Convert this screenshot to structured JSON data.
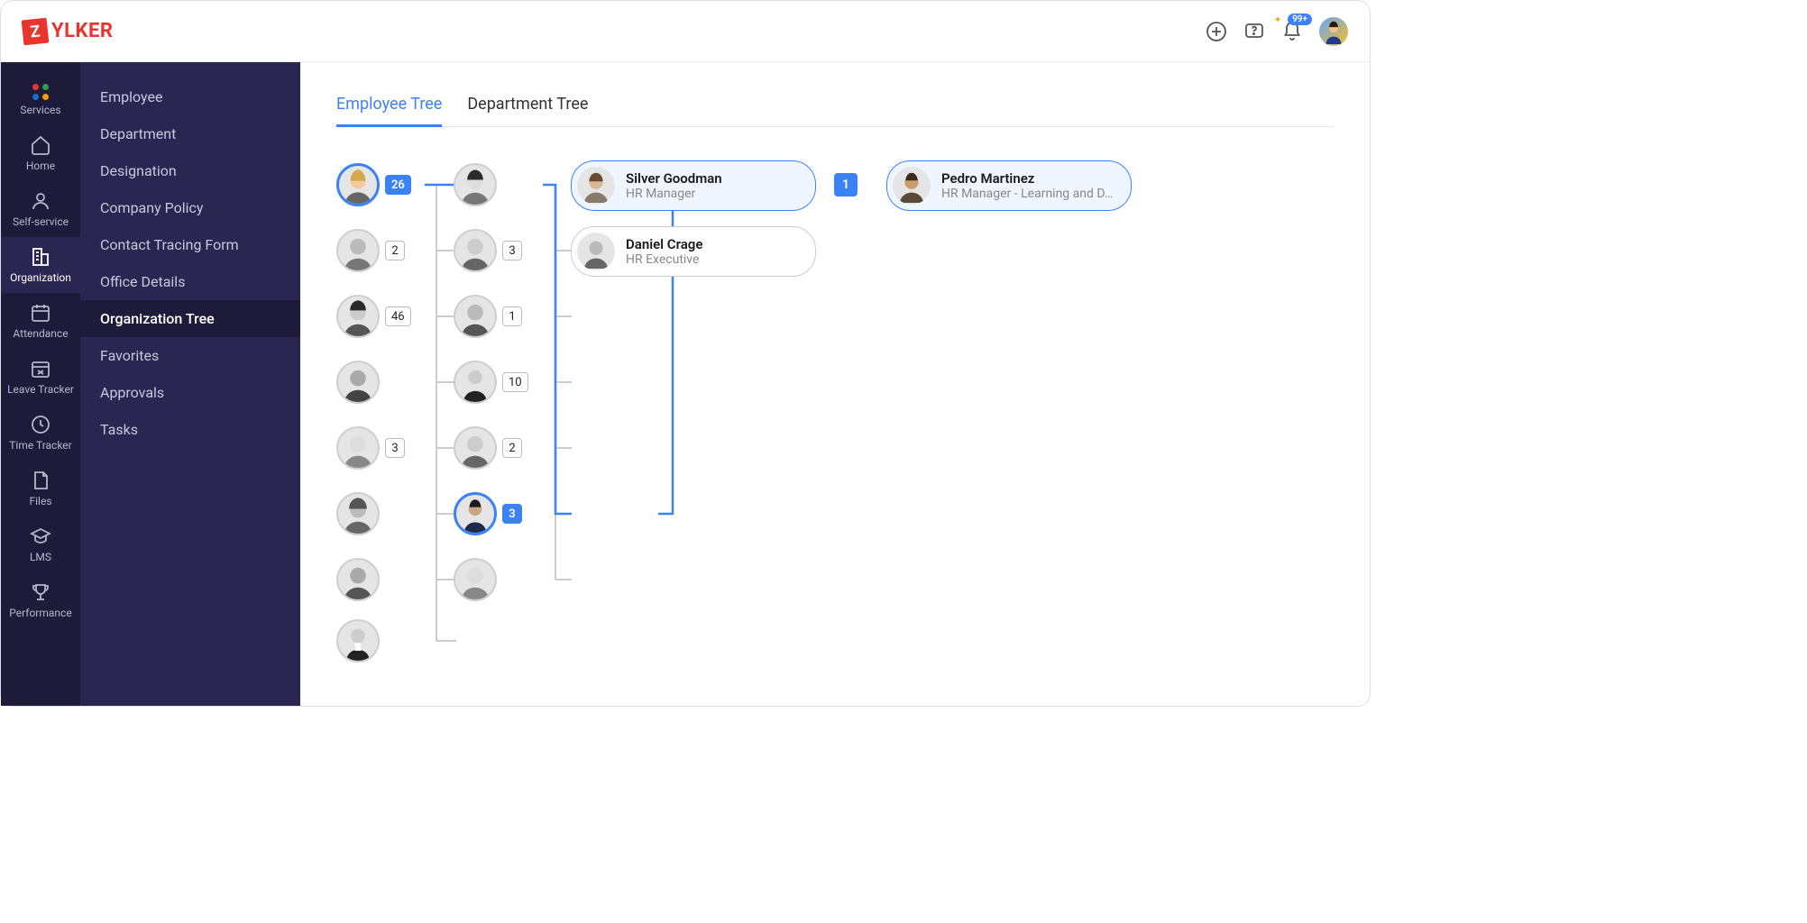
{
  "brand": {
    "badge": "Z",
    "name": "YLKER"
  },
  "header": {
    "notification_count": "99+"
  },
  "rail": {
    "items": [
      {
        "label": "Services"
      },
      {
        "label": "Home"
      },
      {
        "label": "Self-service"
      },
      {
        "label": "Organization"
      },
      {
        "label": "Attendance"
      },
      {
        "label": "Leave Tracker"
      },
      {
        "label": "Time Tracker"
      },
      {
        "label": "Files"
      },
      {
        "label": "LMS"
      },
      {
        "label": "Performance"
      }
    ],
    "active_index": 3
  },
  "subnav": {
    "items": [
      "Employee",
      "Department",
      "Designation",
      "Company Policy",
      "Contact Tracing Form",
      "Office Details",
      "Organization Tree",
      "Favorites",
      "Approvals",
      "Tasks"
    ],
    "active_index": 6
  },
  "tabs": {
    "items": [
      "Employee Tree",
      "Department Tree"
    ],
    "active_index": 0
  },
  "tree": {
    "col1": [
      {
        "count": "26",
        "selected": true
      },
      {
        "count": "2"
      },
      {
        "count": "46"
      },
      {
        "count": null
      },
      {
        "count": "3"
      },
      {
        "count": null
      },
      {
        "count": null
      },
      {
        "count": null
      }
    ],
    "col2": [
      {
        "count": null
      },
      {
        "count": "3"
      },
      {
        "count": "1"
      },
      {
        "count": "10"
      },
      {
        "count": "2"
      },
      {
        "count": "3",
        "selected": true
      },
      {
        "count": null
      }
    ],
    "cards": [
      {
        "name": "Silver Goodman",
        "role": "HR Manager",
        "highlight": true,
        "count": "1"
      },
      {
        "name": "Daniel Crage",
        "role": "HR Executive",
        "highlight": false
      },
      {
        "name": "Pedro Martinez",
        "role": "HR Manager - Learning and D…",
        "highlight": true
      }
    ]
  }
}
